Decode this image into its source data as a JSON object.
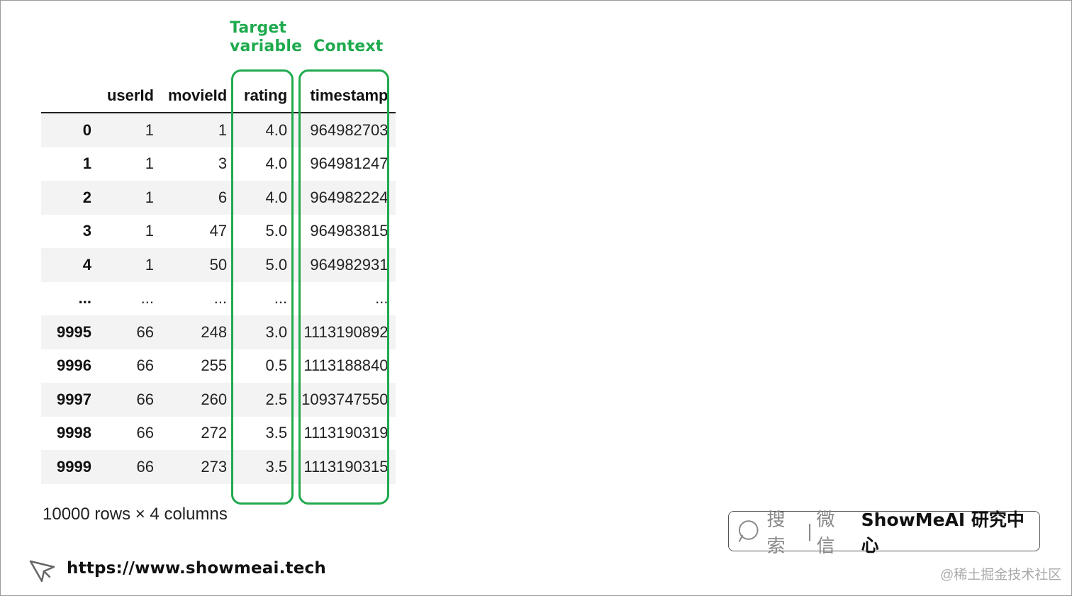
{
  "annotations": {
    "target_line1": "Target",
    "target_line2": "variable",
    "context": "Context",
    "highlight_color": "#1faa4e"
  },
  "table": {
    "columns": [
      "",
      "userId",
      "movieId",
      "rating",
      "timestamp"
    ],
    "rows": [
      [
        "0",
        "1",
        "1",
        "4.0",
        "964982703"
      ],
      [
        "1",
        "1",
        "3",
        "4.0",
        "964981247"
      ],
      [
        "2",
        "1",
        "6",
        "4.0",
        "964982224"
      ],
      [
        "3",
        "1",
        "47",
        "5.0",
        "964983815"
      ],
      [
        "4",
        "1",
        "50",
        "5.0",
        "964982931"
      ],
      [
        "...",
        "...",
        "...",
        "...",
        "..."
      ],
      [
        "9995",
        "66",
        "248",
        "3.0",
        "1113190892"
      ],
      [
        "9996",
        "66",
        "255",
        "0.5",
        "1113188840"
      ],
      [
        "9997",
        "66",
        "260",
        "2.5",
        "1093747550"
      ],
      [
        "9998",
        "66",
        "272",
        "3.5",
        "1113190319"
      ],
      [
        "9999",
        "66",
        "273",
        "3.5",
        "1113190315"
      ]
    ],
    "shape_note": "10000 rows × 4 columns"
  },
  "footer": {
    "url": "https://www.showmeai.tech",
    "search_hint": "搜索",
    "search_sep": "|",
    "search_hint2": "微信",
    "brand": "ShowMeAI 研究中心",
    "watermark": "@稀土掘金技术社区",
    "icons": [
      "cursor-arrow-icon",
      "search-icon"
    ]
  }
}
